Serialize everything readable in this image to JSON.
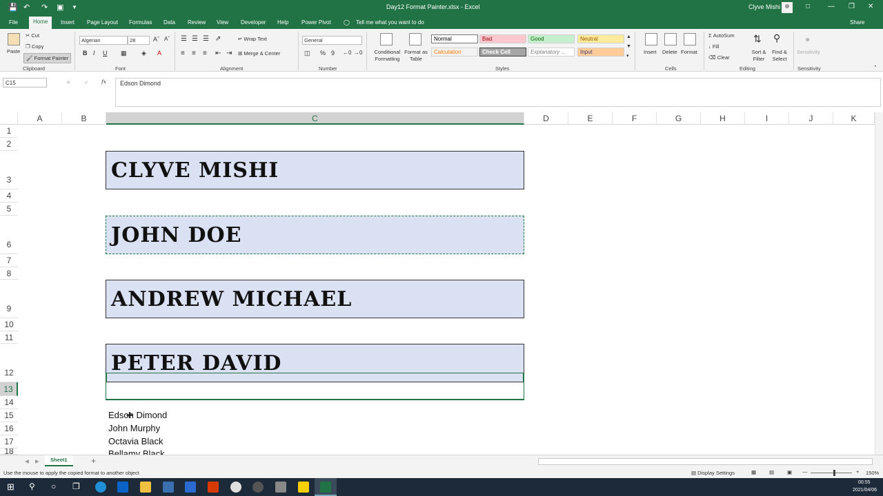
{
  "window": {
    "title": "Day12 Format Painter.xlsx - Excel",
    "user": "Clyve Mishi",
    "share": "Share"
  },
  "tabs": [
    "File",
    "Home",
    "Insert",
    "Page Layout",
    "Formulas",
    "Data",
    "Review",
    "Developer",
    "Help",
    "Power Pivot",
    "Tell me what you want to do"
  ],
  "ribbon": {
    "clipboard": {
      "paste": "Paste",
      "cut": "Cut",
      "copy": "Copy",
      "format_painter": "Format Painter",
      "group": "Clipboard"
    },
    "font": {
      "name": "Algerian",
      "size": "28",
      "bold": "B",
      "italic": "I",
      "underline": "U",
      "group": "Font"
    },
    "alignment": {
      "wrap": "Wrap Text",
      "merge": "Merge & Center",
      "group": "Alignment"
    },
    "number": {
      "format": "General",
      "percent": "%",
      "comma": "9",
      "group": "Number"
    },
    "styles": {
      "conditional": "Conditional Formatting",
      "format_table": "Format as Table",
      "group": "Styles",
      "cells": [
        {
          "label": "Normal",
          "bg": "#ffffff",
          "fg": "#000000"
        },
        {
          "label": "Bad",
          "bg": "#ffc7ce",
          "fg": "#9c0006"
        },
        {
          "label": "Good",
          "bg": "#c6efce",
          "fg": "#006100"
        },
        {
          "label": "Neutral",
          "bg": "#ffeb9c",
          "fg": "#9c5700"
        },
        {
          "label": "Calculation",
          "bg": "#f2f2f2",
          "fg": "#fa7d00"
        },
        {
          "label": "Check Cell",
          "bg": "#a5a5a5",
          "fg": "#ffffff"
        },
        {
          "label": "Explanatory ...",
          "bg": "#ffffff",
          "fg": "#7f7f7f"
        },
        {
          "label": "Input",
          "bg": "#ffcc99",
          "fg": "#3f3f76"
        }
      ]
    },
    "cells": {
      "insert": "Insert",
      "delete": "Delete",
      "format": "Format",
      "group": "Cells"
    },
    "editing": {
      "autosum": "AutoSum",
      "fill": "Fill",
      "clear": "Clear",
      "sort": "Sort & Filter",
      "find": "Find & Select",
      "group": "Editing"
    },
    "sensitivity": {
      "label": "Sensitivity",
      "group": "Sensitivity"
    }
  },
  "formula_bar": {
    "name_box": "C15",
    "fx": "fx",
    "value": "Edson Dimond"
  },
  "columns": [
    "A",
    "B",
    "C",
    "D",
    "E",
    "F",
    "G",
    "H",
    "I",
    "J",
    "K"
  ],
  "rows": [
    "1",
    "2",
    "3",
    "4",
    "5",
    "6",
    "7",
    "8",
    "9",
    "10",
    "11",
    "12",
    "13",
    "14",
    "15",
    "16",
    "17",
    "18"
  ],
  "names_formatted": [
    "CLYVE MISHI",
    "JOHN DOE",
    "ANDREW MICHAEL",
    "PETER DAVID"
  ],
  "names_plain": [
    "Edson Dimond",
    "John Murphy",
    "Octavia Black",
    "Bellamy Black"
  ],
  "sheet": {
    "tab": "Sheet1",
    "add": "+"
  },
  "status": {
    "message": "Use the mouse to apply the copied format to another object",
    "display_settings": "Display Settings",
    "zoom": "150%"
  },
  "taskbar": {
    "time": "00:55",
    "date": "2021/04/06"
  },
  "colors": {
    "excel_green": "#217346",
    "name_fill": "#d9e1f2"
  }
}
